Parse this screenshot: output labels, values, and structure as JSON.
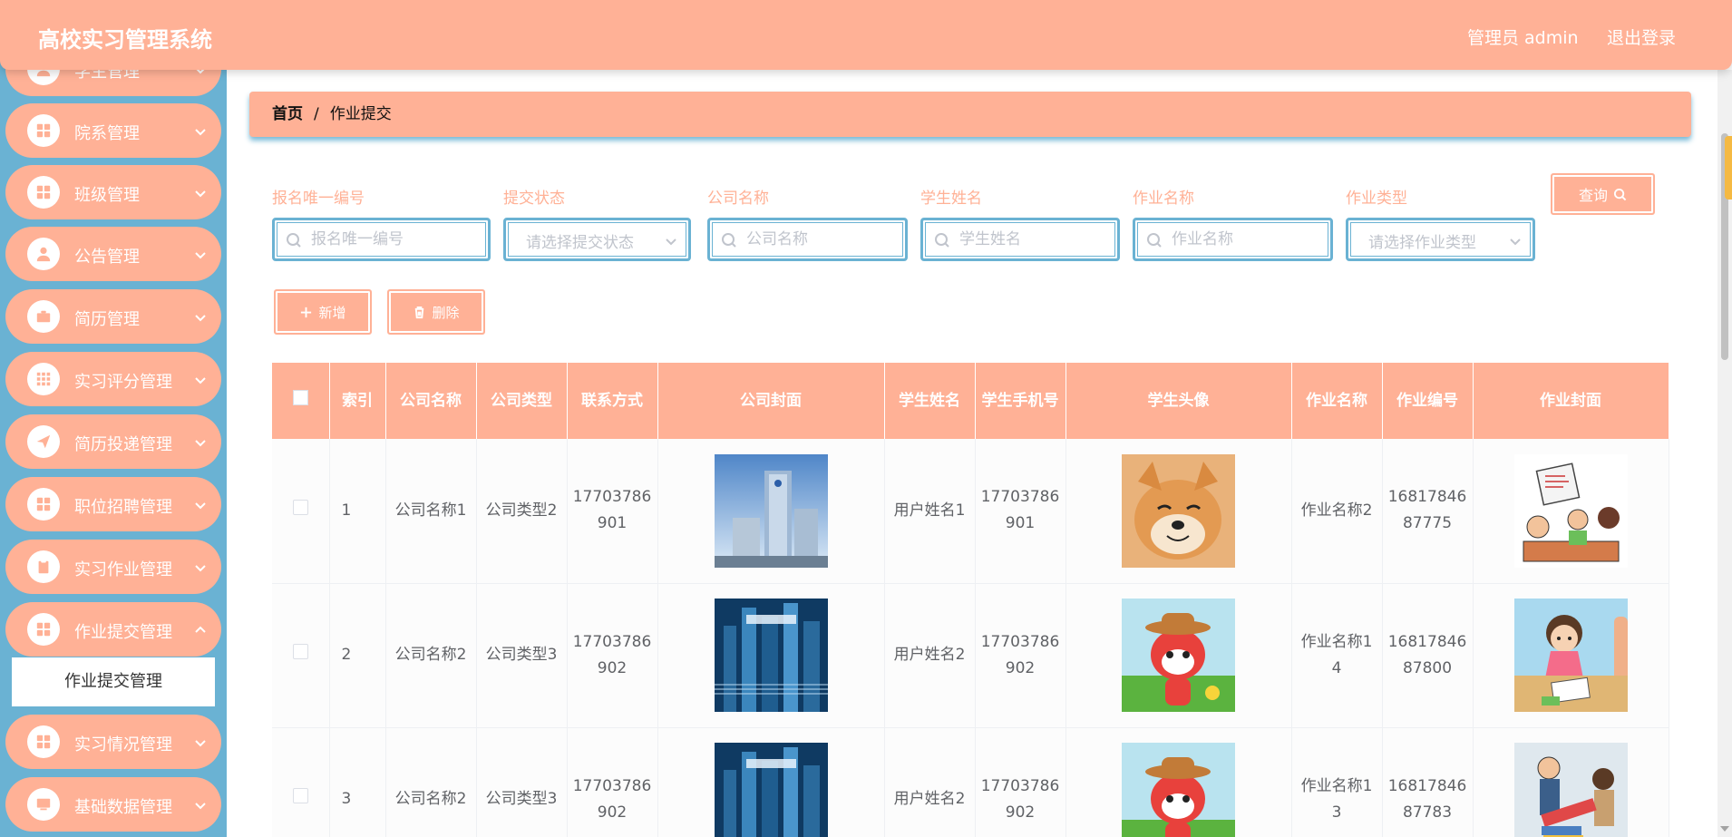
{
  "header": {
    "app_title": "高校实习管理系统",
    "user_label": "管理员 admin",
    "logout_label": "退出登录"
  },
  "sidebar": {
    "items": [
      {
        "label": "学生管理",
        "icon": "user-icon"
      },
      {
        "label": "院系管理",
        "icon": "grid-icon"
      },
      {
        "label": "班级管理",
        "icon": "grid-icon"
      },
      {
        "label": "公告管理",
        "icon": "user-icon"
      },
      {
        "label": "简历管理",
        "icon": "briefcase-icon"
      },
      {
        "label": "实习评分管理",
        "icon": "apps-icon"
      },
      {
        "label": "简历投递管理",
        "icon": "send-icon"
      },
      {
        "label": "职位招聘管理",
        "icon": "grid-icon"
      },
      {
        "label": "实习作业管理",
        "icon": "clipboard-icon"
      },
      {
        "label": "作业提交管理",
        "icon": "grid-icon"
      },
      {
        "label": "实习情况管理",
        "icon": "grid-icon"
      },
      {
        "label": "基础数据管理",
        "icon": "monitor-icon"
      }
    ],
    "active_sub_item": "作业提交管理"
  },
  "breadcrumb": {
    "home": "首页",
    "separator": "/",
    "current": "作业提交"
  },
  "filters": {
    "signup_id": {
      "label": "报名唯一编号",
      "placeholder": "报名唯一编号"
    },
    "submit_status": {
      "label": "提交状态",
      "placeholder": "请选择提交状态"
    },
    "company_name": {
      "label": "公司名称",
      "placeholder": "公司名称"
    },
    "student_name": {
      "label": "学生姓名",
      "placeholder": "学生姓名"
    },
    "homework_name": {
      "label": "作业名称",
      "placeholder": "作业名称"
    },
    "homework_type": {
      "label": "作业类型",
      "placeholder": "请选择作业类型"
    },
    "query_label": "查询"
  },
  "actions": {
    "add_label": "新增",
    "delete_label": "删除"
  },
  "table": {
    "columns": [
      "索引",
      "公司名称",
      "公司类型",
      "联系方式",
      "公司封面",
      "学生姓名",
      "学生手机号",
      "学生头像",
      "作业名称",
      "作业编号",
      "作业封面"
    ],
    "rows": [
      {
        "index": "1",
        "company_name": "公司名称1",
        "company_type": "公司类型2",
        "contact": "17703786901",
        "company_cover": "office-tower",
        "student_name": "用户姓名1",
        "student_phone": "17703786901",
        "student_avatar": "shiba-dog",
        "homework_name": "作业名称2",
        "homework_no": "1681784687775",
        "homework_cover": "cartoon-meeting"
      },
      {
        "index": "2",
        "company_name": "公司名称2",
        "company_type": "公司类型3",
        "contact": "17703786902",
        "company_cover": "blue-city-poster",
        "student_name": "用户姓名2",
        "student_phone": "17703786902",
        "student_avatar": "cartoon-fox",
        "homework_name": "作业名称14",
        "homework_no": "1681784687800",
        "homework_cover": "cartoon-girl-desk"
      },
      {
        "index": "3",
        "company_name": "公司名称2",
        "company_type": "公司类型3",
        "contact": "17703786902",
        "company_cover": "blue-city-poster",
        "student_name": "用户姓名2",
        "student_phone": "17703786902",
        "student_avatar": "cartoon-fox",
        "homework_name": "作业名称13",
        "homework_no": "1681784687783",
        "homework_cover": "cartoon-homework-pile"
      }
    ]
  },
  "colors": {
    "primary": "#ffb196",
    "secondary": "#6ab2d3",
    "placeholder": "#c0c4cc",
    "text": "#606266"
  }
}
